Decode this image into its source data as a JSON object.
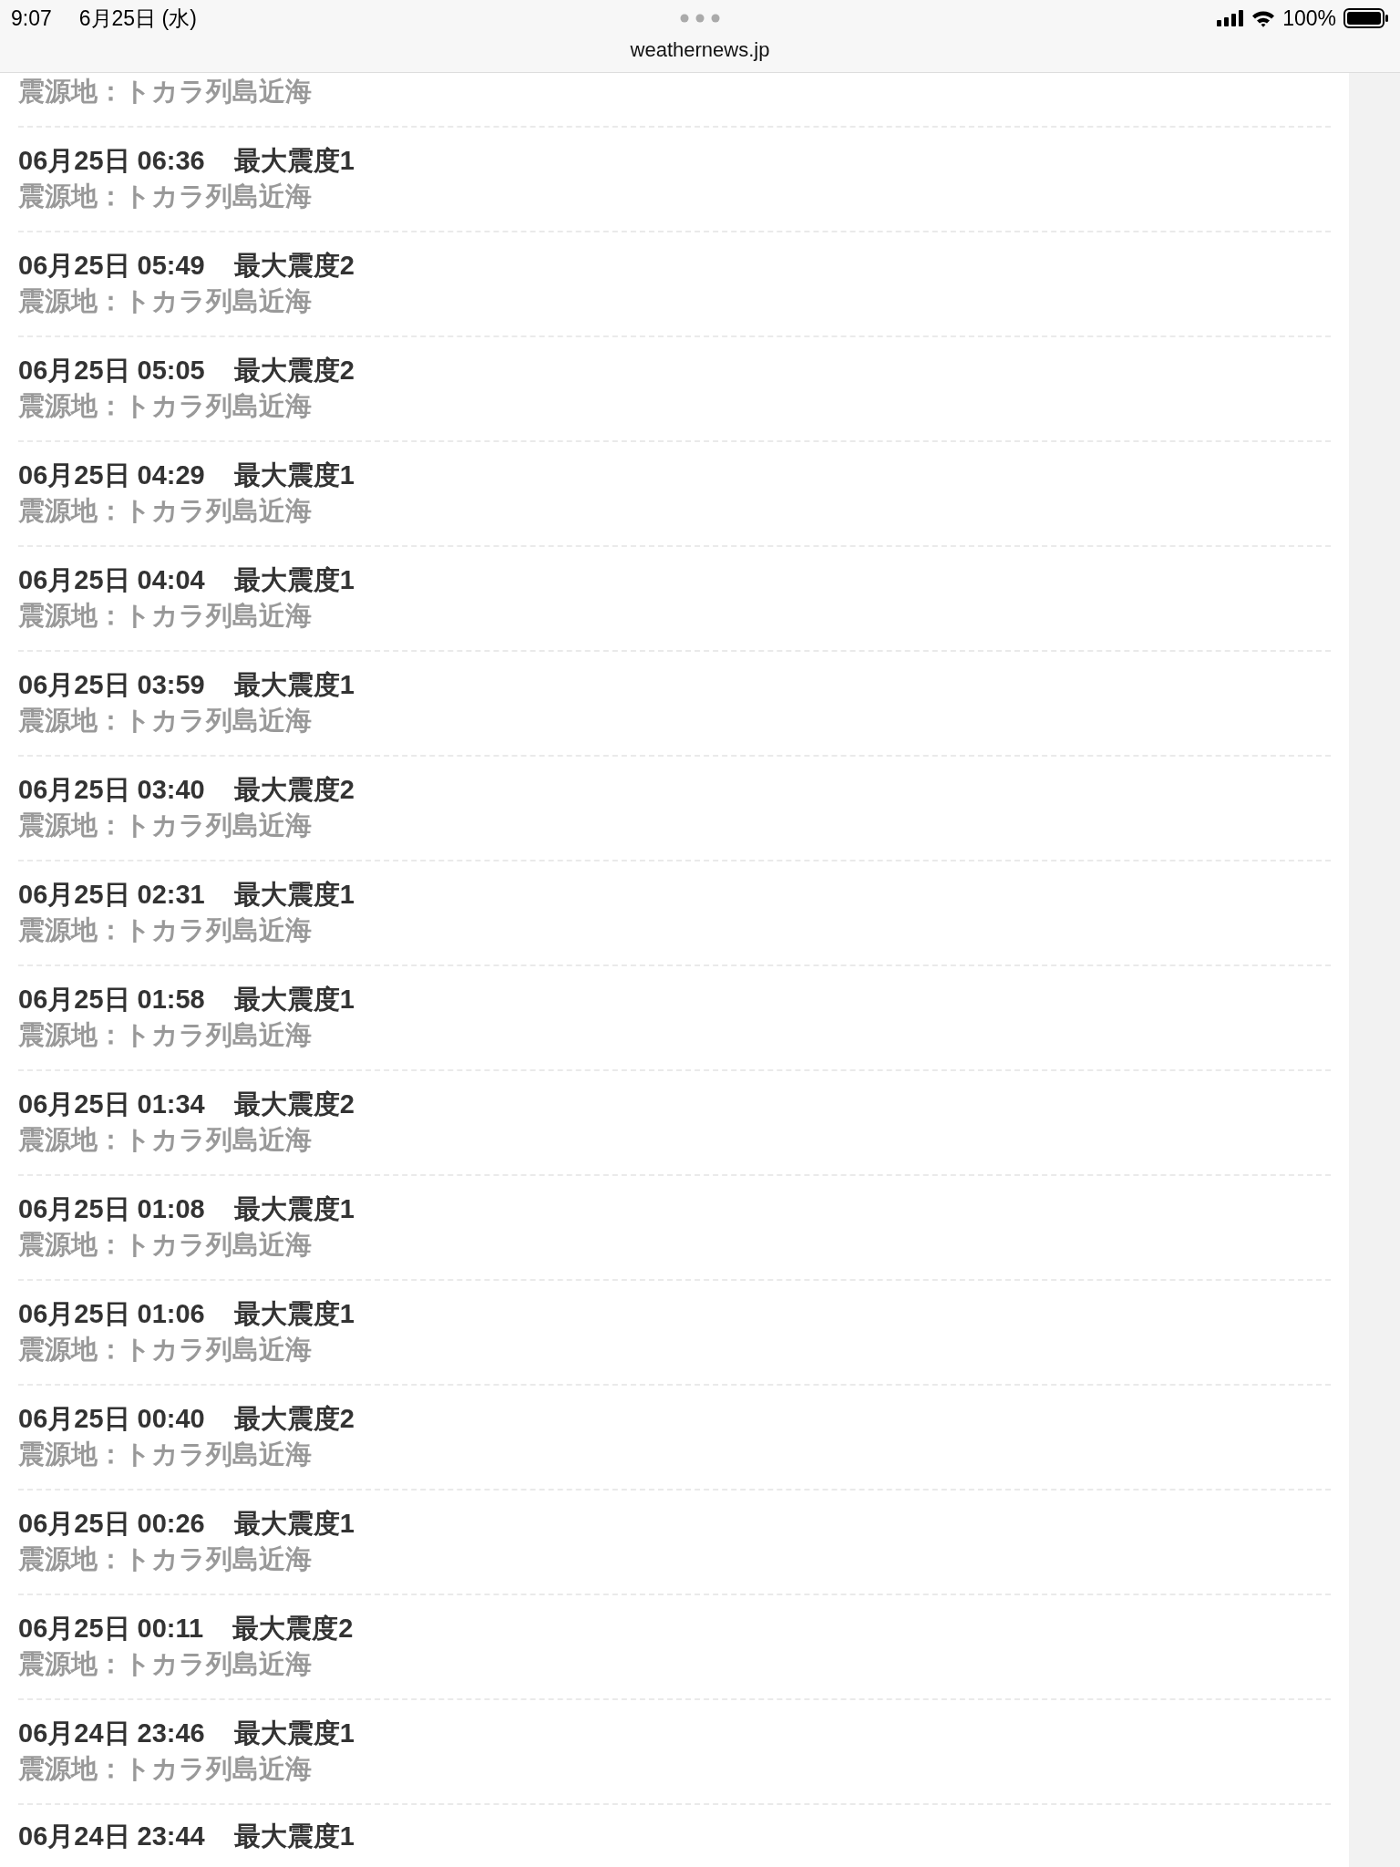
{
  "status_bar": {
    "time": "9:07",
    "date": "6月25日 (水)",
    "battery": "100%"
  },
  "address_bar": {
    "url": "weathernews.jp"
  },
  "quake_list": {
    "top_partial": {
      "epicenter": "震源地：トカラ列島近海"
    },
    "items": [
      {
        "datetime": "06月25日 06:36",
        "intensity": "最大震度1",
        "epicenter": "震源地：トカラ列島近海"
      },
      {
        "datetime": "06月25日 05:49",
        "intensity": "最大震度2",
        "epicenter": "震源地：トカラ列島近海"
      },
      {
        "datetime": "06月25日 05:05",
        "intensity": "最大震度2",
        "epicenter": "震源地：トカラ列島近海"
      },
      {
        "datetime": "06月25日 04:29",
        "intensity": "最大震度1",
        "epicenter": "震源地：トカラ列島近海"
      },
      {
        "datetime": "06月25日 04:04",
        "intensity": "最大震度1",
        "epicenter": "震源地：トカラ列島近海"
      },
      {
        "datetime": "06月25日 03:59",
        "intensity": "最大震度1",
        "epicenter": "震源地：トカラ列島近海"
      },
      {
        "datetime": "06月25日 03:40",
        "intensity": "最大震度2",
        "epicenter": "震源地：トカラ列島近海"
      },
      {
        "datetime": "06月25日 02:31",
        "intensity": "最大震度1",
        "epicenter": "震源地：トカラ列島近海"
      },
      {
        "datetime": "06月25日 01:58",
        "intensity": "最大震度1",
        "epicenter": "震源地：トカラ列島近海"
      },
      {
        "datetime": "06月25日 01:34",
        "intensity": "最大震度2",
        "epicenter": "震源地：トカラ列島近海"
      },
      {
        "datetime": "06月25日 01:08",
        "intensity": "最大震度1",
        "epicenter": "震源地：トカラ列島近海"
      },
      {
        "datetime": "06月25日 01:06",
        "intensity": "最大震度1",
        "epicenter": "震源地：トカラ列島近海"
      },
      {
        "datetime": "06月25日 00:40",
        "intensity": "最大震度2",
        "epicenter": "震源地：トカラ列島近海"
      },
      {
        "datetime": "06月25日 00:26",
        "intensity": "最大震度1",
        "epicenter": "震源地：トカラ列島近海"
      },
      {
        "datetime": "06月25日 00:11",
        "intensity": "最大震度2",
        "epicenter": "震源地：トカラ列島近海"
      },
      {
        "datetime": "06月24日 23:46",
        "intensity": "最大震度1",
        "epicenter": "震源地：トカラ列島近海"
      }
    ],
    "bottom_partial": {
      "datetime": "06月24日 23:44",
      "intensity": "最大震度1"
    }
  }
}
